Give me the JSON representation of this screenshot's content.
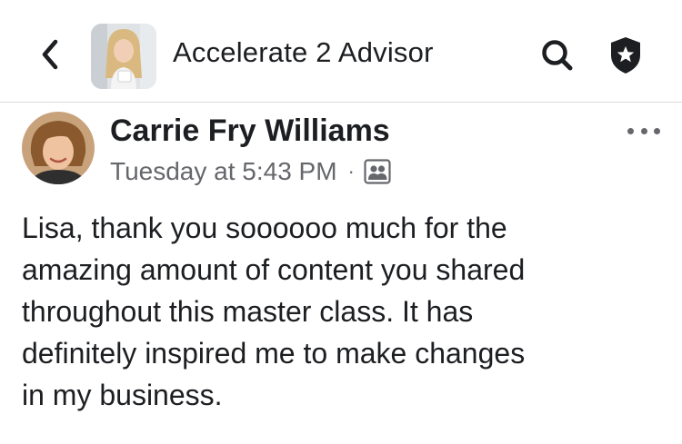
{
  "header": {
    "back_icon": "chevron-left-icon",
    "group_name": "Accelerate 2 Advisor",
    "search_icon": "search-icon",
    "shield_icon": "admin-shield-star-icon"
  },
  "post": {
    "author": "Carrie Fry Williams",
    "timestamp": "Tuesday at 5:43 PM",
    "separator": "·",
    "audience_icon": "group-members-icon",
    "more_icon": "more-options-icon",
    "body": "Lisa, thank you soooooo much for the\namazing amount of content you shared\nthroughout this master class.  It has\ndefinitely inspired me to make changes\nin my business."
  },
  "colors": {
    "text_primary": "#1c1e21",
    "text_secondary": "#65676b",
    "divider": "#d8d8d8",
    "background": "#ffffff"
  }
}
